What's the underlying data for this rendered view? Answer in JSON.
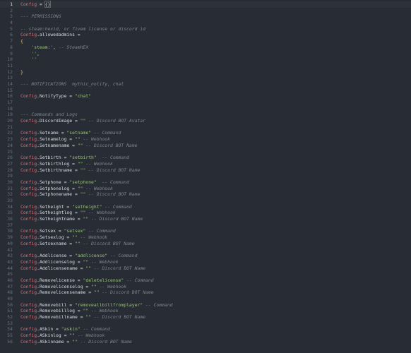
{
  "editor": {
    "lines": [
      {
        "n": "1",
        "active": true,
        "tokens": [
          {
            "t": "Config",
            "c": "var"
          },
          {
            "t": " = ",
            "c": "op"
          },
          {
            "t": "{}",
            "c": "cursor-brace"
          }
        ]
      },
      {
        "n": "2",
        "tokens": []
      },
      {
        "n": "3",
        "tokens": [
          {
            "t": "--- PERMISSIONS",
            "c": "cmt"
          }
        ]
      },
      {
        "n": "4",
        "tokens": []
      },
      {
        "n": "5",
        "tokens": [
          {
            "t": "-- steam:hexid, or fivem license or discord id",
            "c": "cmt"
          }
        ]
      },
      {
        "n": "6",
        "tokens": [
          {
            "t": "Config",
            "c": "var"
          },
          {
            "t": ".allowedadmins =",
            "c": "op"
          }
        ]
      },
      {
        "n": "7",
        "tokens": [
          {
            "t": "{",
            "c": "brace"
          }
        ]
      },
      {
        "n": "8",
        "tokens": [
          {
            "t": "    ",
            "c": "op"
          },
          {
            "t": "'steam:'",
            "c": "str"
          },
          {
            "t": ", ",
            "c": "op"
          },
          {
            "t": "-- SteamHEX",
            "c": "cmt"
          }
        ]
      },
      {
        "n": "9",
        "tokens": [
          {
            "t": "    ",
            "c": "op"
          },
          {
            "t": "''",
            "c": "str"
          },
          {
            "t": ",",
            "c": "op"
          }
        ]
      },
      {
        "n": "10",
        "tokens": [
          {
            "t": "    ",
            "c": "op"
          },
          {
            "t": "''",
            "c": "str"
          }
        ]
      },
      {
        "n": "11",
        "tokens": []
      },
      {
        "n": "12",
        "tokens": [
          {
            "t": "}",
            "c": "brace"
          }
        ]
      },
      {
        "n": "13",
        "tokens": []
      },
      {
        "n": "14",
        "tokens": [
          {
            "t": "--- NOTIFICATIONS  mythic_notify, chat",
            "c": "cmt"
          }
        ]
      },
      {
        "n": "15",
        "tokens": []
      },
      {
        "n": "16",
        "tokens": [
          {
            "t": "Config",
            "c": "var"
          },
          {
            "t": ".NotifyType = ",
            "c": "op"
          },
          {
            "t": "\"chat\"",
            "c": "str"
          }
        ]
      },
      {
        "n": "17",
        "tokens": []
      },
      {
        "n": "18",
        "tokens": []
      },
      {
        "n": "19",
        "tokens": [
          {
            "t": "--- Commands and Logs",
            "c": "cmt"
          }
        ]
      },
      {
        "n": "20",
        "tokens": [
          {
            "t": "Config",
            "c": "var"
          },
          {
            "t": ".DiscordImage = ",
            "c": "op"
          },
          {
            "t": "\"\"",
            "c": "str"
          },
          {
            "t": " -- Discord BOT Avatar",
            "c": "cmt"
          }
        ]
      },
      {
        "n": "21",
        "tokens": []
      },
      {
        "n": "22",
        "tokens": [
          {
            "t": "Config",
            "c": "var"
          },
          {
            "t": ".Setname = ",
            "c": "op"
          },
          {
            "t": "\"setname\"",
            "c": "str"
          },
          {
            "t": " -- Command",
            "c": "cmt"
          }
        ]
      },
      {
        "n": "23",
        "tokens": [
          {
            "t": "Config",
            "c": "var"
          },
          {
            "t": ".Setnamelog = ",
            "c": "op"
          },
          {
            "t": "\"\"",
            "c": "str"
          },
          {
            "t": " -- Webhook",
            "c": "cmt"
          }
        ]
      },
      {
        "n": "24",
        "tokens": [
          {
            "t": "Config",
            "c": "var"
          },
          {
            "t": ".Setnamename = ",
            "c": "op"
          },
          {
            "t": "\"\"",
            "c": "str"
          },
          {
            "t": " -- Discord BOT Name",
            "c": "cmt"
          }
        ]
      },
      {
        "n": "25",
        "tokens": []
      },
      {
        "n": "26",
        "tokens": [
          {
            "t": "Config",
            "c": "var"
          },
          {
            "t": ".Setbirth = ",
            "c": "op"
          },
          {
            "t": "\"setbirth\"",
            "c": "str"
          },
          {
            "t": "  -- Command",
            "c": "cmt"
          }
        ]
      },
      {
        "n": "27",
        "tokens": [
          {
            "t": "Config",
            "c": "var"
          },
          {
            "t": ".Setbirthlog = ",
            "c": "op"
          },
          {
            "t": "\"\"",
            "c": "str"
          },
          {
            "t": " -- Webhook",
            "c": "cmt"
          }
        ]
      },
      {
        "n": "28",
        "tokens": [
          {
            "t": "Config",
            "c": "var"
          },
          {
            "t": ".Setbirthname = ",
            "c": "op"
          },
          {
            "t": "\"\"",
            "c": "str"
          },
          {
            "t": " -- Discord BOT Name",
            "c": "cmt"
          }
        ]
      },
      {
        "n": "29",
        "tokens": []
      },
      {
        "n": "30",
        "tokens": [
          {
            "t": "Config",
            "c": "var"
          },
          {
            "t": ".Setphone = ",
            "c": "op"
          },
          {
            "t": "\"setphone\"",
            "c": "str"
          },
          {
            "t": "  -- Command",
            "c": "cmt"
          }
        ]
      },
      {
        "n": "31",
        "tokens": [
          {
            "t": "Config",
            "c": "var"
          },
          {
            "t": ".Setphonelog = ",
            "c": "op"
          },
          {
            "t": "\"\"",
            "c": "str"
          },
          {
            "t": " -- Webhook",
            "c": "cmt"
          }
        ]
      },
      {
        "n": "32",
        "tokens": [
          {
            "t": "Config",
            "c": "var"
          },
          {
            "t": ".Setphonename = ",
            "c": "op"
          },
          {
            "t": "\"\"",
            "c": "str"
          },
          {
            "t": " -- Discord BOT Name",
            "c": "cmt"
          }
        ]
      },
      {
        "n": "33",
        "tokens": []
      },
      {
        "n": "34",
        "tokens": [
          {
            "t": "Config",
            "c": "var"
          },
          {
            "t": ".Setheight = ",
            "c": "op"
          },
          {
            "t": "\"setheight\"",
            "c": "str"
          },
          {
            "t": " -- Command",
            "c": "cmt"
          }
        ]
      },
      {
        "n": "35",
        "tokens": [
          {
            "t": "Config",
            "c": "var"
          },
          {
            "t": ".Setheightlog = ",
            "c": "op"
          },
          {
            "t": "\"\"",
            "c": "str"
          },
          {
            "t": " -- Webhook",
            "c": "cmt"
          }
        ]
      },
      {
        "n": "36",
        "tokens": [
          {
            "t": "Config",
            "c": "var"
          },
          {
            "t": ".Setheightname = ",
            "c": "op"
          },
          {
            "t": "\"\"",
            "c": "str"
          },
          {
            "t": " -- Discord BOT Name",
            "c": "cmt"
          }
        ]
      },
      {
        "n": "37",
        "tokens": []
      },
      {
        "n": "38",
        "tokens": [
          {
            "t": "Config",
            "c": "var"
          },
          {
            "t": ".Setsex = ",
            "c": "op"
          },
          {
            "t": "\"setsex\"",
            "c": "str"
          },
          {
            "t": " -- Command",
            "c": "cmt"
          }
        ]
      },
      {
        "n": "39",
        "tokens": [
          {
            "t": "Config",
            "c": "var"
          },
          {
            "t": ".Setsexlog = ",
            "c": "op"
          },
          {
            "t": "\"\"",
            "c": "str"
          },
          {
            "t": " -- Webhook",
            "c": "cmt"
          }
        ]
      },
      {
        "n": "40",
        "tokens": [
          {
            "t": "Config",
            "c": "var"
          },
          {
            "t": ".Setsexname = ",
            "c": "op"
          },
          {
            "t": "\"\"",
            "c": "str"
          },
          {
            "t": " -- Discord BOT Name",
            "c": "cmt"
          }
        ]
      },
      {
        "n": "41",
        "tokens": []
      },
      {
        "n": "42",
        "tokens": [
          {
            "t": "Config",
            "c": "var"
          },
          {
            "t": ".Addlicense = ",
            "c": "op"
          },
          {
            "t": "\"addlicense\"",
            "c": "str"
          },
          {
            "t": " -- Command",
            "c": "cmt"
          }
        ]
      },
      {
        "n": "43",
        "tokens": [
          {
            "t": "Config",
            "c": "var"
          },
          {
            "t": ".Addlicenselog = ",
            "c": "op"
          },
          {
            "t": "\"\"",
            "c": "str"
          },
          {
            "t": " -- Webhook",
            "c": "cmt"
          }
        ]
      },
      {
        "n": "44",
        "tokens": [
          {
            "t": "Config",
            "c": "var"
          },
          {
            "t": ".Addlicensename = ",
            "c": "op"
          },
          {
            "t": "\"\"",
            "c": "str"
          },
          {
            "t": " -- Discord BOT Name",
            "c": "cmt"
          }
        ]
      },
      {
        "n": "45",
        "tokens": []
      },
      {
        "n": "46",
        "tokens": [
          {
            "t": "Config",
            "c": "var"
          },
          {
            "t": ".Removelicense = ",
            "c": "op"
          },
          {
            "t": "\"deletelicense\"",
            "c": "str"
          },
          {
            "t": " -- Command",
            "c": "cmt"
          }
        ]
      },
      {
        "n": "47",
        "tokens": [
          {
            "t": "Config",
            "c": "var"
          },
          {
            "t": ".Removelicenselog = ",
            "c": "op"
          },
          {
            "t": "\"\"",
            "c": "str"
          },
          {
            "t": " -- Webhook",
            "c": "cmt"
          }
        ]
      },
      {
        "n": "48",
        "tokens": [
          {
            "t": "Config",
            "c": "var"
          },
          {
            "t": ".Removelicensename = ",
            "c": "op"
          },
          {
            "t": "\"\"",
            "c": "str"
          },
          {
            "t": " -- Discord BOT Name",
            "c": "cmt"
          }
        ]
      },
      {
        "n": "49",
        "tokens": []
      },
      {
        "n": "50",
        "tokens": [
          {
            "t": "Config",
            "c": "var"
          },
          {
            "t": ".Removebill = ",
            "c": "op"
          },
          {
            "t": "\"removeallbillfromplayer\"",
            "c": "str"
          },
          {
            "t": " -- Command",
            "c": "cmt"
          }
        ]
      },
      {
        "n": "51",
        "tokens": [
          {
            "t": "Config",
            "c": "var"
          },
          {
            "t": ".Removebilllog = ",
            "c": "op"
          },
          {
            "t": "\"\"",
            "c": "str"
          },
          {
            "t": " -- Webhook",
            "c": "cmt"
          }
        ]
      },
      {
        "n": "52",
        "tokens": [
          {
            "t": "Config",
            "c": "var"
          },
          {
            "t": ".Removebillname = ",
            "c": "op"
          },
          {
            "t": "\"\"",
            "c": "str"
          },
          {
            "t": " -- Discord BOT Name",
            "c": "cmt"
          }
        ]
      },
      {
        "n": "53",
        "tokens": []
      },
      {
        "n": "54",
        "tokens": [
          {
            "t": "Config",
            "c": "var"
          },
          {
            "t": ".ASkin = ",
            "c": "op"
          },
          {
            "t": "\"askin\"",
            "c": "str"
          },
          {
            "t": " -- Command",
            "c": "cmt"
          }
        ]
      },
      {
        "n": "55",
        "tokens": [
          {
            "t": "Config",
            "c": "var"
          },
          {
            "t": ".ASkinlog = ",
            "c": "op"
          },
          {
            "t": "\"\"",
            "c": "str"
          },
          {
            "t": " -- Webhook",
            "c": "cmt"
          }
        ]
      },
      {
        "n": "56",
        "tokens": [
          {
            "t": "Config",
            "c": "var"
          },
          {
            "t": ".ASkinname = ",
            "c": "op"
          },
          {
            "t": "\"\"",
            "c": "str"
          },
          {
            "t": " -- Discord BOT Name",
            "c": "cmt"
          }
        ]
      }
    ]
  }
}
